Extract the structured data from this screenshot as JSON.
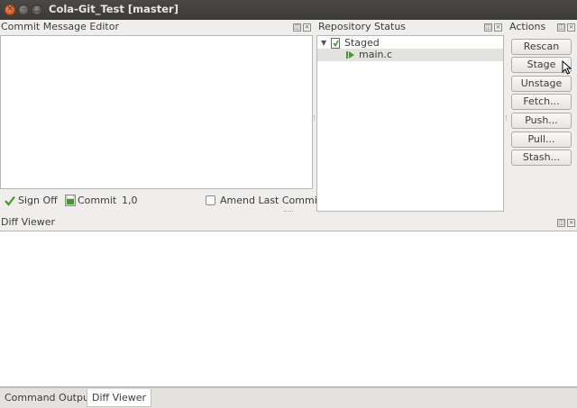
{
  "window": {
    "title": "Cola-Git_Test [master]",
    "close_glyph": "×",
    "minimize_glyph": "–",
    "maximize_glyph": "□"
  },
  "commit_editor": {
    "title": "Commit Message Editor",
    "sign_off_label": "Sign Off",
    "commit_label": "Commit",
    "cursor_position": "1,0",
    "amend_label": "Amend Last Commit",
    "amend_checked": false
  },
  "repo_status": {
    "title": "Repository Status",
    "groups": [
      {
        "label": "Staged",
        "files": [
          {
            "name": "main.c"
          }
        ]
      }
    ]
  },
  "actions": {
    "title": "Actions",
    "buttons": [
      "Rescan",
      "Stage",
      "Unstage",
      "Fetch...",
      "Push...",
      "Pull...",
      "Stash..."
    ]
  },
  "diff_viewer": {
    "title": "Diff Viewer"
  },
  "bottom_tabs": [
    {
      "label": "Command Output",
      "active": false
    },
    {
      "label": "Diff Viewer",
      "active": true
    }
  ],
  "dock_controls": {
    "float_glyph": "◫",
    "close_glyph": "×"
  },
  "colors": {
    "titlebar": "#3b3a37",
    "close_button": "#e0571f",
    "staged_icon": "#3f9b2b"
  }
}
